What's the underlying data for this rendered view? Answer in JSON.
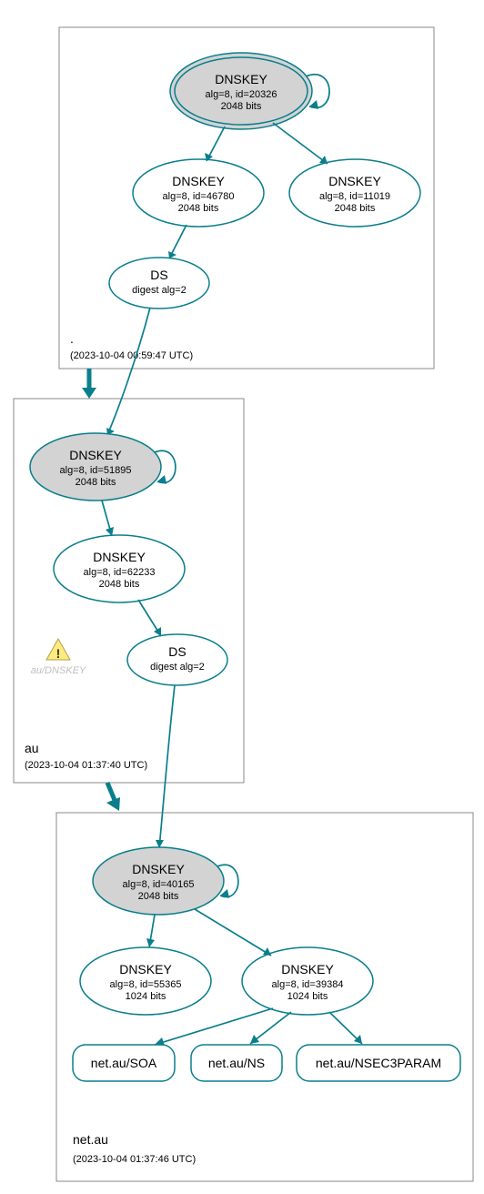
{
  "zones": {
    "root": {
      "label": ".",
      "timestamp": "(2023-10-04 00:59:47 UTC)"
    },
    "au": {
      "label": "au",
      "timestamp": "(2023-10-04 01:37:40 UTC)"
    },
    "netau": {
      "label": "net.au",
      "timestamp": "(2023-10-04 01:37:46 UTC)"
    }
  },
  "nodes": {
    "root_ksk": {
      "title": "DNSKEY",
      "sub1": "alg=8, id=20326",
      "sub2": "2048 bits"
    },
    "root_zsk1": {
      "title": "DNSKEY",
      "sub1": "alg=8, id=46780",
      "sub2": "2048 bits"
    },
    "root_zsk2": {
      "title": "DNSKEY",
      "sub1": "alg=8, id=11019",
      "sub2": "2048 bits"
    },
    "root_ds": {
      "title": "DS",
      "sub1": "digest alg=2"
    },
    "au_ksk": {
      "title": "DNSKEY",
      "sub1": "alg=8, id=51895",
      "sub2": "2048 bits"
    },
    "au_zsk": {
      "title": "DNSKEY",
      "sub1": "alg=8, id=62233",
      "sub2": "2048 bits"
    },
    "au_ds": {
      "title": "DS",
      "sub1": "digest alg=2"
    },
    "au_warn": {
      "label": "au/DNSKEY"
    },
    "netau_ksk": {
      "title": "DNSKEY",
      "sub1": "alg=8, id=40165",
      "sub2": "2048 bits"
    },
    "netau_zsk1": {
      "title": "DNSKEY",
      "sub1": "alg=8, id=55365",
      "sub2": "1024 bits"
    },
    "netau_zsk2": {
      "title": "DNSKEY",
      "sub1": "alg=8, id=39384",
      "sub2": "1024 bits"
    },
    "rr_soa": {
      "label": "net.au/SOA"
    },
    "rr_ns": {
      "label": "net.au/NS"
    },
    "rr_nsec3": {
      "label": "net.au/NSEC3PARAM"
    }
  }
}
